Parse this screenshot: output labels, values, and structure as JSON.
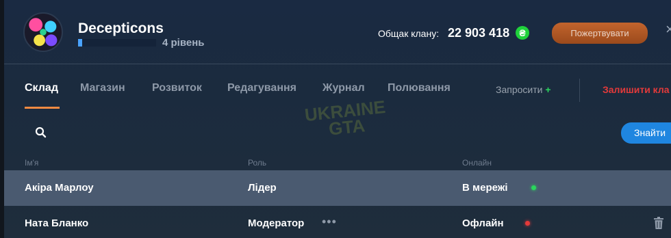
{
  "header": {
    "clan_name": "Decepticons",
    "level_text": "4 рівень",
    "level_progress": 0.05,
    "total_label": "Общак клану:",
    "total_value": "22 903 418",
    "currency_symbol": "₴",
    "donate_label": "Пожертвувати"
  },
  "tabs": [
    {
      "label": "Склад",
      "active": true
    },
    {
      "label": "Магазин",
      "active": false
    },
    {
      "label": "Розвиток",
      "active": false
    },
    {
      "label": "Редагування",
      "active": false
    },
    {
      "label": "Журнал",
      "active": false
    },
    {
      "label": "Полювання",
      "active": false
    }
  ],
  "actions": {
    "invite_label": "Запросити",
    "invite_plus": "+",
    "leave_label": "Залишити кла"
  },
  "watermark": {
    "line1": "UKRAINE",
    "line2": "GTA"
  },
  "search": {
    "find_label": "Знайти"
  },
  "table": {
    "headers": {
      "name": "Ім'я",
      "role": "Роль",
      "online": "Онлайн"
    },
    "rows": [
      {
        "name": "Акіра Марлоу",
        "role": "Лідер",
        "status": "В мережі",
        "status_color": "#2ad65c",
        "more": "",
        "removable": false
      },
      {
        "name": "Ната Бланко",
        "role": "Модератор",
        "status": "Офлайн",
        "status_color": "#e33a3a",
        "more": "•••",
        "removable": true
      }
    ]
  },
  "colors": {
    "accent_orange": "#f28a42",
    "online_green": "#2ad65c",
    "offline_red": "#e33a3a",
    "primary_blue": "#1f86e0"
  }
}
